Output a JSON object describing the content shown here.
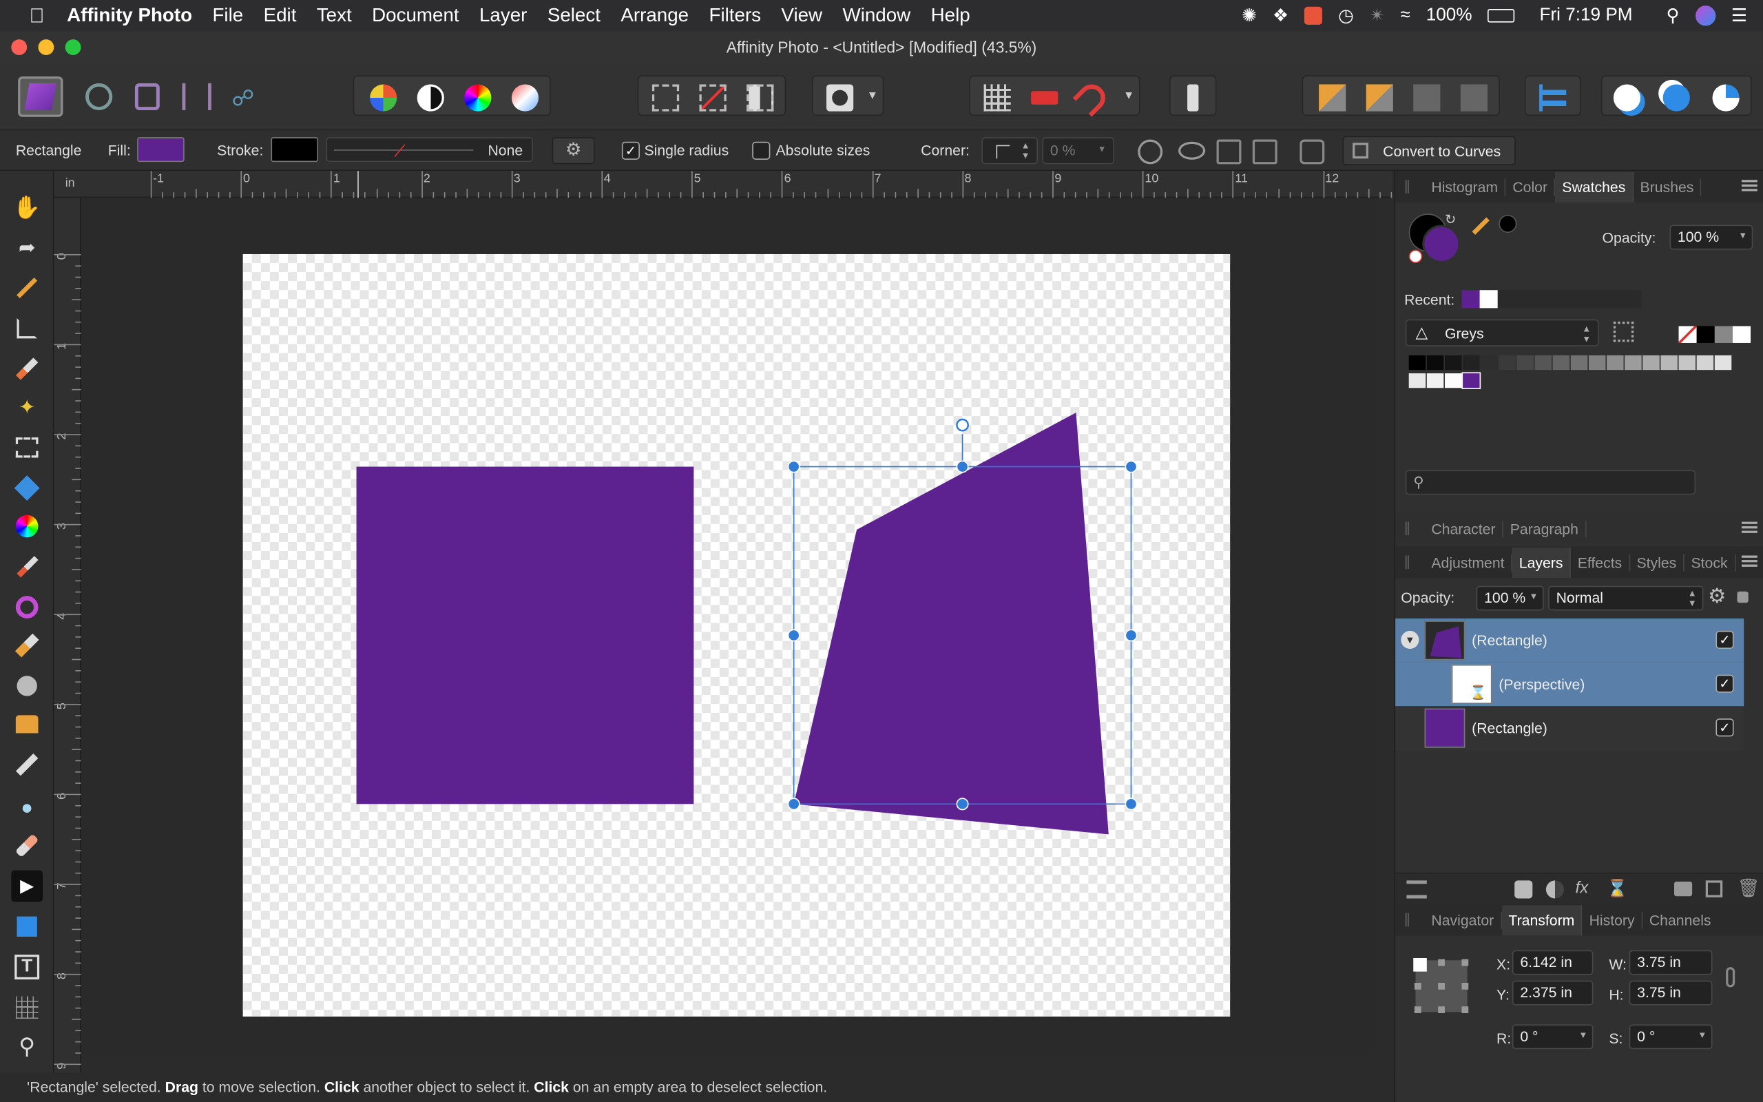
{
  "menubar": {
    "app_name": "Affinity Photo",
    "items": [
      "File",
      "Edit",
      "Text",
      "Document",
      "Layer",
      "Select",
      "Arrange",
      "Filters",
      "View",
      "Window",
      "Help"
    ],
    "battery": "100%",
    "clock": "Fri 7:19 PM"
  },
  "window": {
    "title": "Affinity Photo - <Untitled> [Modified] (43.5%)"
  },
  "context_bar": {
    "tool_name": "Rectangle",
    "fill_label": "Fill:",
    "stroke_label": "Stroke:",
    "stroke_style": "None",
    "single_radius_label": "Single radius",
    "single_radius_checked": true,
    "absolute_sizes_label": "Absolute sizes",
    "absolute_sizes_checked": false,
    "corner_label": "Corner:",
    "corner_value": "0 %",
    "convert_label": "Convert to Curves",
    "fill_color": "#5e2290",
    "stroke_color": "#000000"
  },
  "ruler": {
    "unit": "in",
    "h_ticks": [
      "-1",
      "0",
      "1",
      "2",
      "3",
      "4",
      "5",
      "6",
      "7",
      "8",
      "9",
      "10",
      "11",
      "12"
    ],
    "v_ticks": [
      "0",
      "1",
      "2",
      "3",
      "4",
      "5",
      "6",
      "7",
      "8",
      "9"
    ]
  },
  "status_bar": {
    "part1": "'Rectangle' selected. ",
    "b1": "Drag",
    "part2": " to move selection. ",
    "b2": "Click",
    "part3": " another object to select it. ",
    "b3": "Click",
    "part4": " on an empty area to deselect selection."
  },
  "panels": {
    "top_tabs": [
      "Histogram",
      "Color",
      "Swatches",
      "Brushes"
    ],
    "top_active": "Swatches",
    "swatches": {
      "opacity_label": "Opacity:",
      "opacity_value": "100 %",
      "recent_label": "Recent:",
      "palette_name": "Greys",
      "primary_color": "#5e2290",
      "secondary_color": "#000000",
      "search_placeholder": ""
    },
    "mid_tabs": [
      "Character",
      "Paragraph"
    ],
    "layer_tabs": [
      "Adjustment",
      "Layers",
      "Effects",
      "Styles",
      "Stock"
    ],
    "layer_active": "Layers",
    "layers": {
      "opacity_label": "Opacity:",
      "opacity_value": "100 %",
      "blend_mode": "Normal",
      "items": [
        {
          "name": "(Rectangle)",
          "selected": true,
          "visible": true
        },
        {
          "name": "(Perspective)",
          "selected": true,
          "visible": true
        },
        {
          "name": "(Rectangle)",
          "selected": false,
          "visible": true
        }
      ]
    },
    "bottom_tabs": [
      "Navigator",
      "Transform",
      "History",
      "Channels"
    ],
    "bottom_active": "Transform",
    "transform": {
      "x_label": "X:",
      "x": "6.142 in",
      "y_label": "Y:",
      "y": "2.375 in",
      "w_label": "W:",
      "w": "3.75 in",
      "h_label": "H:",
      "h": "3.75 in",
      "r_label": "R:",
      "r": "0 °",
      "s_label": "S:",
      "s": "0 °"
    }
  },
  "colors": {
    "purple": "#5e2290",
    "selection": "#2f7bd6"
  }
}
